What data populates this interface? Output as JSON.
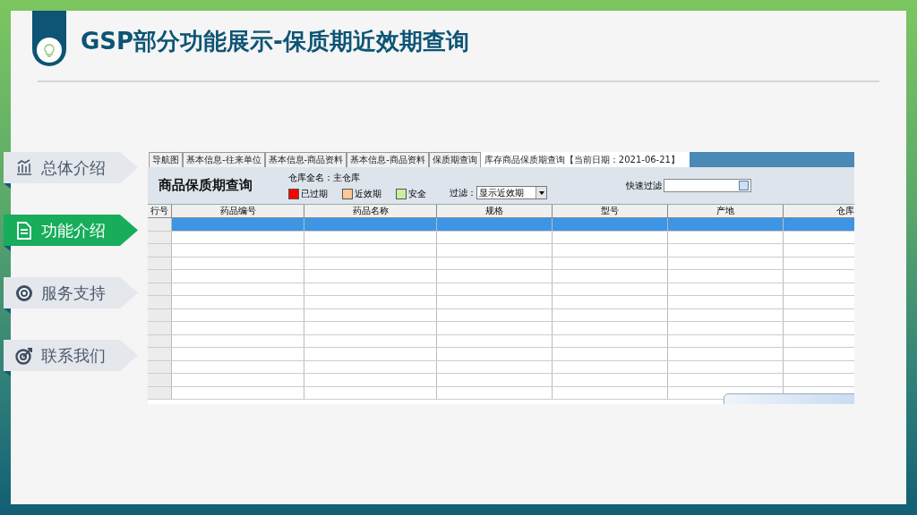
{
  "slide": {
    "title": "GSP部分功能展示-保质期近效期查询"
  },
  "nav": [
    {
      "label": "总体介绍",
      "selected": false,
      "kind": "chart"
    },
    {
      "label": "功能介绍",
      "selected": true,
      "kind": "document"
    },
    {
      "label": "服务支持",
      "selected": false,
      "kind": "target"
    },
    {
      "label": "联系我们",
      "selected": false,
      "kind": "dart"
    }
  ],
  "app": {
    "tabs": [
      {
        "label": "导航图",
        "selected": false
      },
      {
        "label": "基本信息-往来单位",
        "selected": false
      },
      {
        "label": "基本信息-商品资料",
        "selected": false
      },
      {
        "label": "基本信息-商品资料",
        "selected": false
      },
      {
        "label": "保质期查询",
        "selected": false
      },
      {
        "label": "库存商品保质期查询【当前日期：2021-06-21】",
        "selected": true
      }
    ],
    "heading": "商品保质期查询",
    "warehouse": "仓库全名：主仓库",
    "legend": [
      {
        "label": "已过期",
        "color": "#ff0000"
      },
      {
        "label": "近效期",
        "color": "#ffc896"
      },
      {
        "label": "安全",
        "color": "#c8f0a0"
      }
    ],
    "filter": {
      "label": "过滤：",
      "value": "显示近效期"
    },
    "quick_filter": {
      "label": "快速过滤"
    },
    "table": {
      "columns": [
        "行号",
        "药品编号",
        "药品名称",
        "规格",
        "型号",
        "产地",
        "仓库"
      ],
      "rows": [
        {
          "selected": true
        },
        {
          "selected": false
        },
        {
          "selected": false
        },
        {
          "selected": false
        },
        {
          "selected": false
        },
        {
          "selected": false
        },
        {
          "selected": false
        },
        {
          "selected": false
        },
        {
          "selected": false
        },
        {
          "selected": false
        },
        {
          "selected": false
        },
        {
          "selected": false
        },
        {
          "selected": false
        },
        {
          "selected": false
        }
      ]
    }
  }
}
